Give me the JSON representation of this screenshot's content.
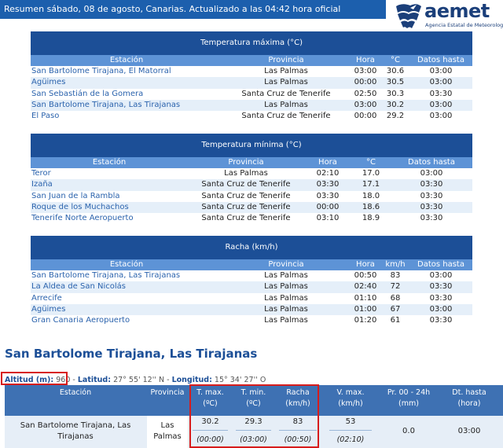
{
  "header": {
    "summary": "Resumen sábado, 08 de agosto, Canarias. Actualizado a las 04:42 hora oficial",
    "logo_text": "aemet",
    "logo_subtitle": "Agencia Estatal de Meteorología"
  },
  "colors": {
    "header_blue": "#1c5fad",
    "table_title": "#1c4f97",
    "column_header": "#5d93d6",
    "row_alt": "#e5eff9",
    "link": "#2b63ad",
    "highlight": "#d71c1c"
  },
  "tables": {
    "tmax": {
      "title": "Temperatura máxima (°C)",
      "columns": [
        "Estación",
        "Provincia",
        "Hora",
        "°C",
        "Datos hasta"
      ],
      "rows": [
        [
          "San Bartolome Tirajana, El Matorral",
          "Las Palmas",
          "03:00",
          "30.6",
          "03:00"
        ],
        [
          "Agüimes",
          "Las Palmas",
          "00:00",
          "30.5",
          "03:00"
        ],
        [
          "San Sebastián de la Gomera",
          "Santa Cruz de Tenerife",
          "02:50",
          "30.3",
          "03:30"
        ],
        [
          "San Bartolome Tirajana, Las Tirajanas",
          "Las Palmas",
          "03:00",
          "30.2",
          "03:00"
        ],
        [
          "El Paso",
          "Santa Cruz de Tenerife",
          "00:00",
          "29.2",
          "03:00"
        ]
      ]
    },
    "tmin": {
      "title": "Temperatura mínima (°C)",
      "columns": [
        "Estación",
        "Provincia",
        "Hora",
        "°C",
        "Datos hasta"
      ],
      "rows": [
        [
          "Teror",
          "Las Palmas",
          "02:10",
          "17.0",
          "03:00"
        ],
        [
          "Izaña",
          "Santa Cruz de Tenerife",
          "03:30",
          "17.1",
          "03:30"
        ],
        [
          "San Juan de la Rambla",
          "Santa Cruz de Tenerife",
          "03:30",
          "18.0",
          "03:30"
        ],
        [
          "Roque de los Muchachos",
          "Santa Cruz de Tenerife",
          "00:00",
          "18.6",
          "03:30"
        ],
        [
          "Tenerife Norte Aeropuerto",
          "Santa Cruz de Tenerife",
          "03:10",
          "18.9",
          "03:30"
        ]
      ]
    },
    "racha": {
      "title": "Racha (km/h)",
      "columns": [
        "Estación",
        "Provincia",
        "Hora",
        "km/h",
        "Datos hasta"
      ],
      "rows": [
        [
          "San Bartolome Tirajana, Las Tirajanas",
          "Las Palmas",
          "00:50",
          "83",
          "03:00"
        ],
        [
          "La Aldea de San Nicolás",
          "Las Palmas",
          "02:40",
          "72",
          "03:30"
        ],
        [
          "Arrecife",
          "Las Palmas",
          "01:10",
          "68",
          "03:30"
        ],
        [
          "Agüimes",
          "Las Palmas",
          "01:00",
          "67",
          "03:00"
        ],
        [
          "Gran Canaria Aeropuerto",
          "Las Palmas",
          "01:20",
          "61",
          "03:30"
        ]
      ]
    }
  },
  "station": {
    "title": "San Bartolome Tirajana, Las Tirajanas",
    "altitud_label": "Altitud (m):",
    "altitud_value": "960",
    "latitud_label": "Latitud:",
    "latitud_value": "27° 55' 12'' N",
    "longitud_label": "Longitud:",
    "longitud_value": "15° 34' 27'' O",
    "separator": " - ",
    "headers": {
      "estacion": "Estación",
      "provincia": "Provincia",
      "tmax": "T. max.",
      "tmax_unit": "(ºC)",
      "tmin": "T. min.",
      "tmin_unit": "(ºC)",
      "racha": "Racha",
      "racha_unit": "(km/h)",
      "vmax": "V. max.",
      "vmax_unit": "(km/h)",
      "prec": "Pr. 00 - 24h",
      "prec_unit": "(mm)",
      "dt": "Dt. hasta",
      "dt_unit": "(hora)"
    },
    "row": {
      "estacion_line1": "San Bartolome Tirajana, Las",
      "estacion_line2": "Tirajanas",
      "provincia_line1": "Las",
      "provincia_line2": "Palmas",
      "tmax": "30.2",
      "tmax_time": "(00:00)",
      "tmin": "29.3",
      "tmin_time": "(03:00)",
      "racha": "83",
      "racha_time": "(00:50)",
      "vmax": "53",
      "vmax_time": "(02:10)",
      "prec": "0.0",
      "dt": "03:00"
    }
  }
}
